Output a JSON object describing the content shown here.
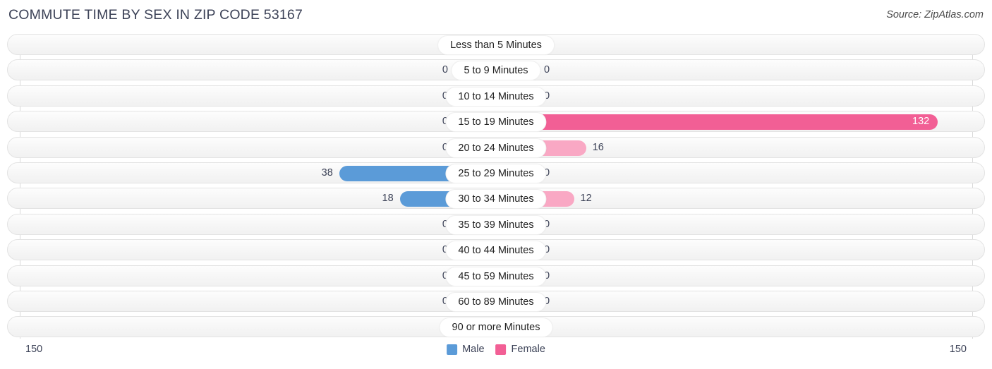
{
  "header": {
    "title": "COMMUTE TIME BY SEX IN ZIP CODE 53167",
    "source": "Source: ZipAtlas.com"
  },
  "legend": {
    "male_label": "Male",
    "female_label": "Female",
    "male_color": "#5b9bd8",
    "female_color": "#f25f95"
  },
  "axis": {
    "left_tick": "150",
    "right_tick": "150",
    "max": 150
  },
  "chart_data": {
    "type": "bar",
    "title": "COMMUTE TIME BY SEX IN ZIP CODE 53167",
    "subtitle": "Source: ZipAtlas.com",
    "orientation": "horizontal-diverging",
    "xlabel": "",
    "ylabel": "",
    "xlim": [
      150,
      150
    ],
    "grid": false,
    "legend_position": "bottom-center",
    "categories": [
      "Less than 5 Minutes",
      "5 to 9 Minutes",
      "10 to 14 Minutes",
      "15 to 19 Minutes",
      "20 to 24 Minutes",
      "25 to 29 Minutes",
      "30 to 34 Minutes",
      "35 to 39 Minutes",
      "40 to 44 Minutes",
      "45 to 59 Minutes",
      "60 to 89 Minutes",
      "90 or more Minutes"
    ],
    "series": [
      {
        "name": "Male",
        "color": "#5b9bd8",
        "values": [
          0,
          0,
          0,
          0,
          0,
          38,
          18,
          0,
          0,
          0,
          0,
          0
        ]
      },
      {
        "name": "Female",
        "color": "#f25f95",
        "values": [
          0,
          0,
          0,
          132,
          16,
          0,
          12,
          0,
          0,
          0,
          0,
          0
        ]
      }
    ]
  }
}
